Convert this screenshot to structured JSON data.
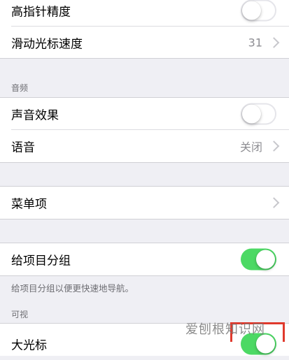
{
  "top_group": {
    "rows": [
      {
        "label": "高指针精度",
        "switch_on": false
      },
      {
        "label": "滑动光标速度",
        "value": "31"
      }
    ]
  },
  "audio_section": {
    "header": "音频",
    "rows": [
      {
        "label": "声音效果",
        "switch_on": false
      },
      {
        "label": "语音",
        "value": "关闭"
      }
    ]
  },
  "menu_section": {
    "rows": [
      {
        "label": "菜单项"
      }
    ]
  },
  "group_section": {
    "rows": [
      {
        "label": "给项目分组",
        "switch_on": true
      }
    ],
    "footer": "给项目分组以便更快速地导航。"
  },
  "visual_section": {
    "header": "可视",
    "rows": [
      {
        "label": "大光标",
        "switch_on": true
      }
    ]
  },
  "watermark": "爱刨根知识网",
  "colors": {
    "background": "#efeff4",
    "switch_on": "#4cd964",
    "secondary_text": "#8e8e93"
  }
}
